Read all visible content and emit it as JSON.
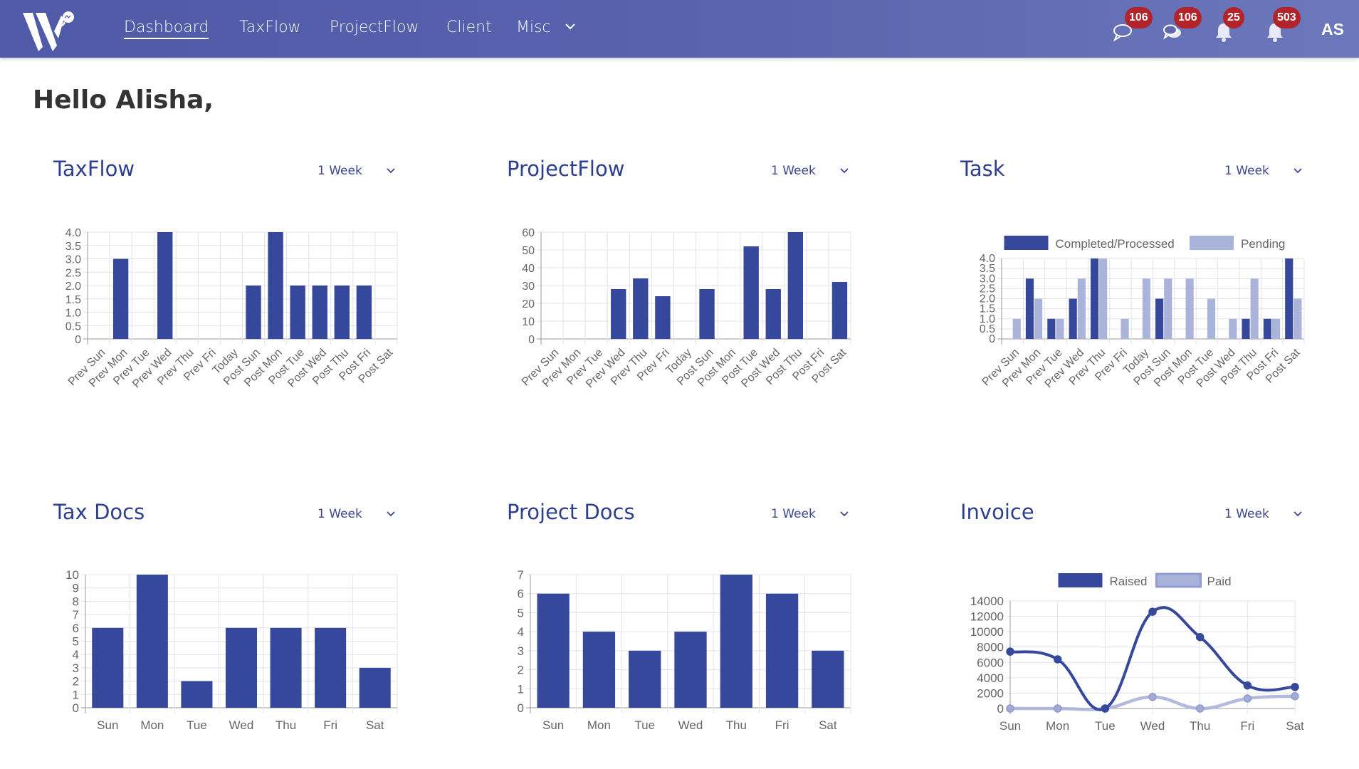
{
  "header": {
    "logo_alt": "W logo",
    "nav": [
      {
        "label": "Dashboard",
        "active": true
      },
      {
        "label": "TaxFlow",
        "active": false
      },
      {
        "label": "ProjectFlow",
        "active": false
      },
      {
        "label": "Client",
        "active": false
      },
      {
        "label": "Misc",
        "active": false,
        "has_dropdown": true
      }
    ],
    "icons": [
      {
        "name": "chat-icon",
        "badge": "106"
      },
      {
        "name": "chats-icon",
        "badge": "106"
      },
      {
        "name": "bell-icon",
        "badge": "25"
      },
      {
        "name": "bell-icon",
        "badge": "503"
      }
    ],
    "avatar_initials": "AS"
  },
  "greeting": "Hello Alisha,",
  "colors": {
    "header": "#5260ad",
    "primary": "#36489c",
    "secondary": "#aab3d9",
    "badge": "#b3242a",
    "title": "#2e3f8f"
  },
  "cards": [
    {
      "title": "TaxFlow",
      "range": "1 Week"
    },
    {
      "title": "ProjectFlow",
      "range": "1 Week"
    },
    {
      "title": "Task",
      "range": "1 Week"
    },
    {
      "title": "Tax Docs",
      "range": "1 Week"
    },
    {
      "title": "Project Docs",
      "range": "1 Week"
    },
    {
      "title": "Invoice",
      "range": "1 Week"
    }
  ],
  "chart_data": [
    {
      "id": "taxflow",
      "type": "bar",
      "title": "TaxFlow",
      "categories": [
        "Prev Sun",
        "Prev Mon",
        "Prev Tue",
        "Prev Wed",
        "Prev Thu",
        "Prev Fri",
        "Today",
        "Post Sun",
        "Post Mon",
        "Post Tue",
        "Post Wed",
        "Post Thu",
        "Post Fri",
        "Post Sat"
      ],
      "values": [
        0,
        3,
        0,
        4,
        0,
        0,
        0,
        2,
        4,
        2,
        2,
        2,
        2,
        0
      ],
      "ylim": [
        0,
        4
      ],
      "yticks": [
        "0",
        "0.5",
        "1.0",
        "1.5",
        "2.0",
        "2.5",
        "3.0",
        "3.5",
        "4.0"
      ],
      "ystep": 0.5,
      "grid": true,
      "xlabel_rotation": "angled"
    },
    {
      "id": "projectflow",
      "type": "bar",
      "title": "ProjectFlow",
      "categories": [
        "Prev Sun",
        "Prev Mon",
        "Prev Tue",
        "Prev Wed",
        "Prev Thu",
        "Prev Fri",
        "Today",
        "Post Sun",
        "Post Mon",
        "Post Tue",
        "Post Wed",
        "Post Thu",
        "Post Fri",
        "Post Sat"
      ],
      "values": [
        0,
        0,
        0,
        28,
        34,
        24,
        0,
        28,
        0,
        52,
        28,
        60,
        0,
        32
      ],
      "ylim": [
        0,
        60
      ],
      "yticks": [
        "0",
        "10",
        "20",
        "30",
        "40",
        "50",
        "60"
      ],
      "ystep": 10,
      "grid": true,
      "xlabel_rotation": "angled"
    },
    {
      "id": "task",
      "type": "bar",
      "title": "Task",
      "categories": [
        "Prev Sun",
        "Prev Mon",
        "Prev Tue",
        "Prev Wed",
        "Prev Thu",
        "Prev Fri",
        "Today",
        "Post Sun",
        "Post Mon",
        "Post Tue",
        "Post Wed",
        "Post Thu",
        "Post Fri",
        "Post Sat"
      ],
      "series": [
        {
          "name": "Completed/Processed",
          "color": "#36489c",
          "values": [
            0,
            3,
            1,
            2,
            4,
            0,
            0,
            2,
            0,
            0,
            0,
            1,
            1,
            4
          ]
        },
        {
          "name": "Pending",
          "color": "#aab3d9",
          "values": [
            1,
            2,
            1,
            3,
            4,
            1,
            3,
            3,
            3,
            2,
            1,
            3,
            1,
            2
          ]
        }
      ],
      "ylim": [
        0,
        4
      ],
      "yticks": [
        "0",
        "0.5",
        "1.0",
        "1.5",
        "2.0",
        "2.5",
        "3.0",
        "3.5",
        "4.0"
      ],
      "ystep": 0.5,
      "legend": "top",
      "grid": true,
      "xlabel_rotation": "angled"
    },
    {
      "id": "taxdocs",
      "type": "bar",
      "title": "Tax Docs",
      "categories": [
        "Sun",
        "Mon",
        "Tue",
        "Wed",
        "Thu",
        "Fri",
        "Sat"
      ],
      "values": [
        6,
        10,
        2,
        6,
        6,
        6,
        3
      ],
      "ylim": [
        0,
        10
      ],
      "yticks": [
        "0",
        "1",
        "2",
        "3",
        "4",
        "5",
        "6",
        "7",
        "8",
        "9",
        "10"
      ],
      "ystep": 1,
      "grid": true
    },
    {
      "id": "projectdocs",
      "type": "bar",
      "title": "Project Docs",
      "categories": [
        "Sun",
        "Mon",
        "Tue",
        "Wed",
        "Thu",
        "Fri",
        "Sat"
      ],
      "values": [
        6,
        4,
        3,
        4,
        7,
        6,
        3
      ],
      "ylim": [
        0,
        7
      ],
      "yticks": [
        "0",
        "1",
        "2",
        "3",
        "4",
        "5",
        "6",
        "7"
      ],
      "ystep": 1,
      "grid": true
    },
    {
      "id": "invoice",
      "type": "line",
      "title": "Invoice",
      "categories": [
        "Sun",
        "Mon",
        "Tue",
        "Wed",
        "Thu",
        "Fri",
        "Sat"
      ],
      "series": [
        {
          "name": "Raised",
          "color": "#36489c",
          "values": [
            7400,
            6400,
            0,
            12600,
            9300,
            3000,
            2800
          ]
        },
        {
          "name": "Paid",
          "color": "#aab3d9",
          "values": [
            0,
            0,
            0,
            1500,
            0,
            1300,
            1600
          ]
        }
      ],
      "ylim": [
        0,
        14000
      ],
      "yticks": [
        "0",
        "2000",
        "4000",
        "6000",
        "8000",
        "10000",
        "12000",
        "14000"
      ],
      "ystep": 2000,
      "legend": "top",
      "grid": true,
      "smooth": true
    }
  ]
}
